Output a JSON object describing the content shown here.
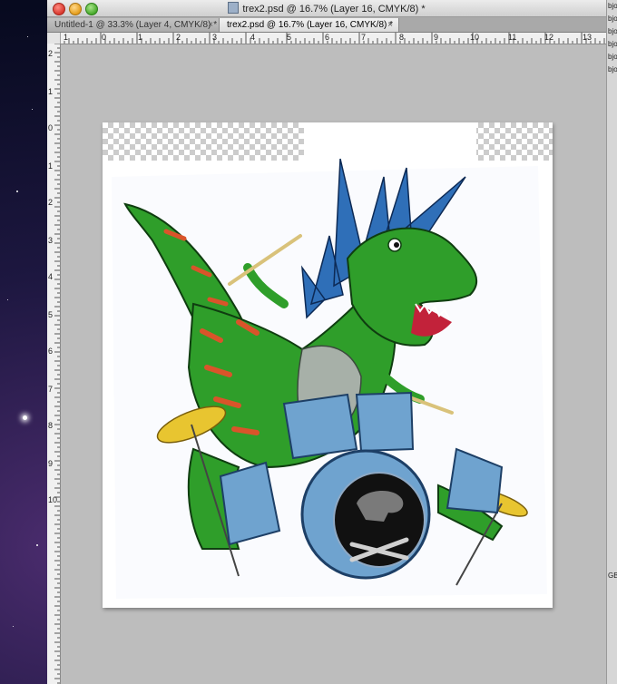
{
  "window": {
    "title": "trex2.psd @ 16.7% (Layer 16, CMYK/8) *"
  },
  "tabs": [
    {
      "label": "Untitled-1 @ 33.3% (Layer 4, CMYK/8) *",
      "close": "×"
    },
    {
      "label": "trex2.psd @ 16.7% (Layer 16, CMYK/8) *",
      "close": "×"
    }
  ],
  "ruler_h": [
    "1",
    "0",
    "1",
    "2",
    "3",
    "4",
    "5",
    "6",
    "7",
    "8",
    "9",
    "10",
    "11",
    "12",
    "13"
  ],
  "ruler_v": [
    "2",
    "1",
    "0",
    "1",
    "2",
    "3",
    "4",
    "5",
    "6",
    "7",
    "8",
    "9",
    "10"
  ],
  "side_panel": [
    "bjo",
    "bjo",
    "bjo",
    "bjo",
    "bjo",
    "bjo",
    "GB"
  ],
  "colors": {
    "dino_green": "#2f9e2a",
    "dino_stripes": "#d9542a",
    "mohawk_blue": "#2f6fb8",
    "drum_blue": "#6fa3cf",
    "cymbal_yellow": "#e8c530",
    "canvas_bg": "#bdbdbd"
  }
}
